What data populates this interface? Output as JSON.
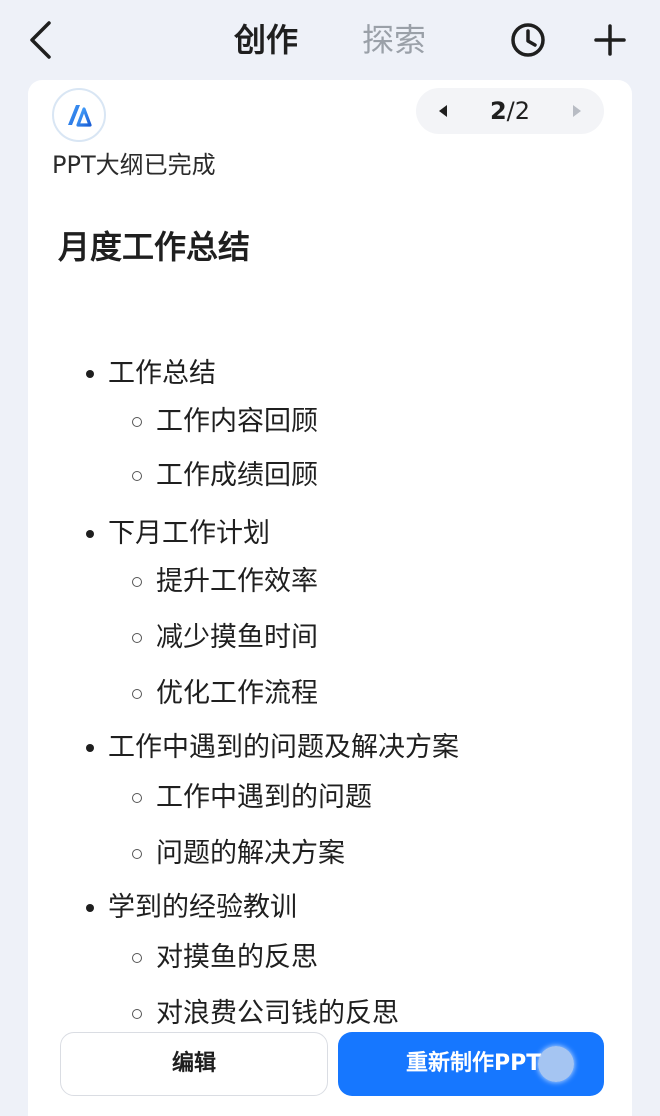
{
  "header": {
    "tabs": [
      {
        "label": "创作",
        "active": true
      },
      {
        "label": "探索",
        "active": false
      }
    ],
    "icons": [
      "back-icon",
      "history-icon",
      "plus-icon"
    ]
  },
  "message": {
    "avatar_icon": "ai-logo-icon",
    "pager": {
      "current": "2",
      "total": "/2"
    },
    "status": "PPT大纲已完成",
    "title": "月度工作总结",
    "outline": [
      {
        "level": 1,
        "text": "工作总结"
      },
      {
        "level": 2,
        "text": "工作内容回顾"
      },
      {
        "level": 2,
        "text": "工作成绩回顾"
      },
      {
        "level": 1,
        "text": "下月工作计划"
      },
      {
        "level": 2,
        "text": "提升工作效率"
      },
      {
        "level": 2,
        "text": "减少摸鱼时间"
      },
      {
        "level": 2,
        "text": "优化工作流程"
      },
      {
        "level": 1,
        "text": "工作中遇到的问题及解决方案"
      },
      {
        "level": 2,
        "text": "工作中遇到的问题"
      },
      {
        "level": 2,
        "text": "问题的解决方案"
      },
      {
        "level": 1,
        "text": "学到的经验教训"
      },
      {
        "level": 2,
        "text": "对摸鱼的反思"
      },
      {
        "level": 2,
        "text": "对浪费公司钱的反思"
      }
    ]
  },
  "actions": {
    "edit_label": "编辑",
    "remake_label": "重新制作PPT"
  },
  "colors": {
    "accent": "#1677ff",
    "background": "#eef1f8",
    "inactive_tab": "#9aa0a8"
  }
}
